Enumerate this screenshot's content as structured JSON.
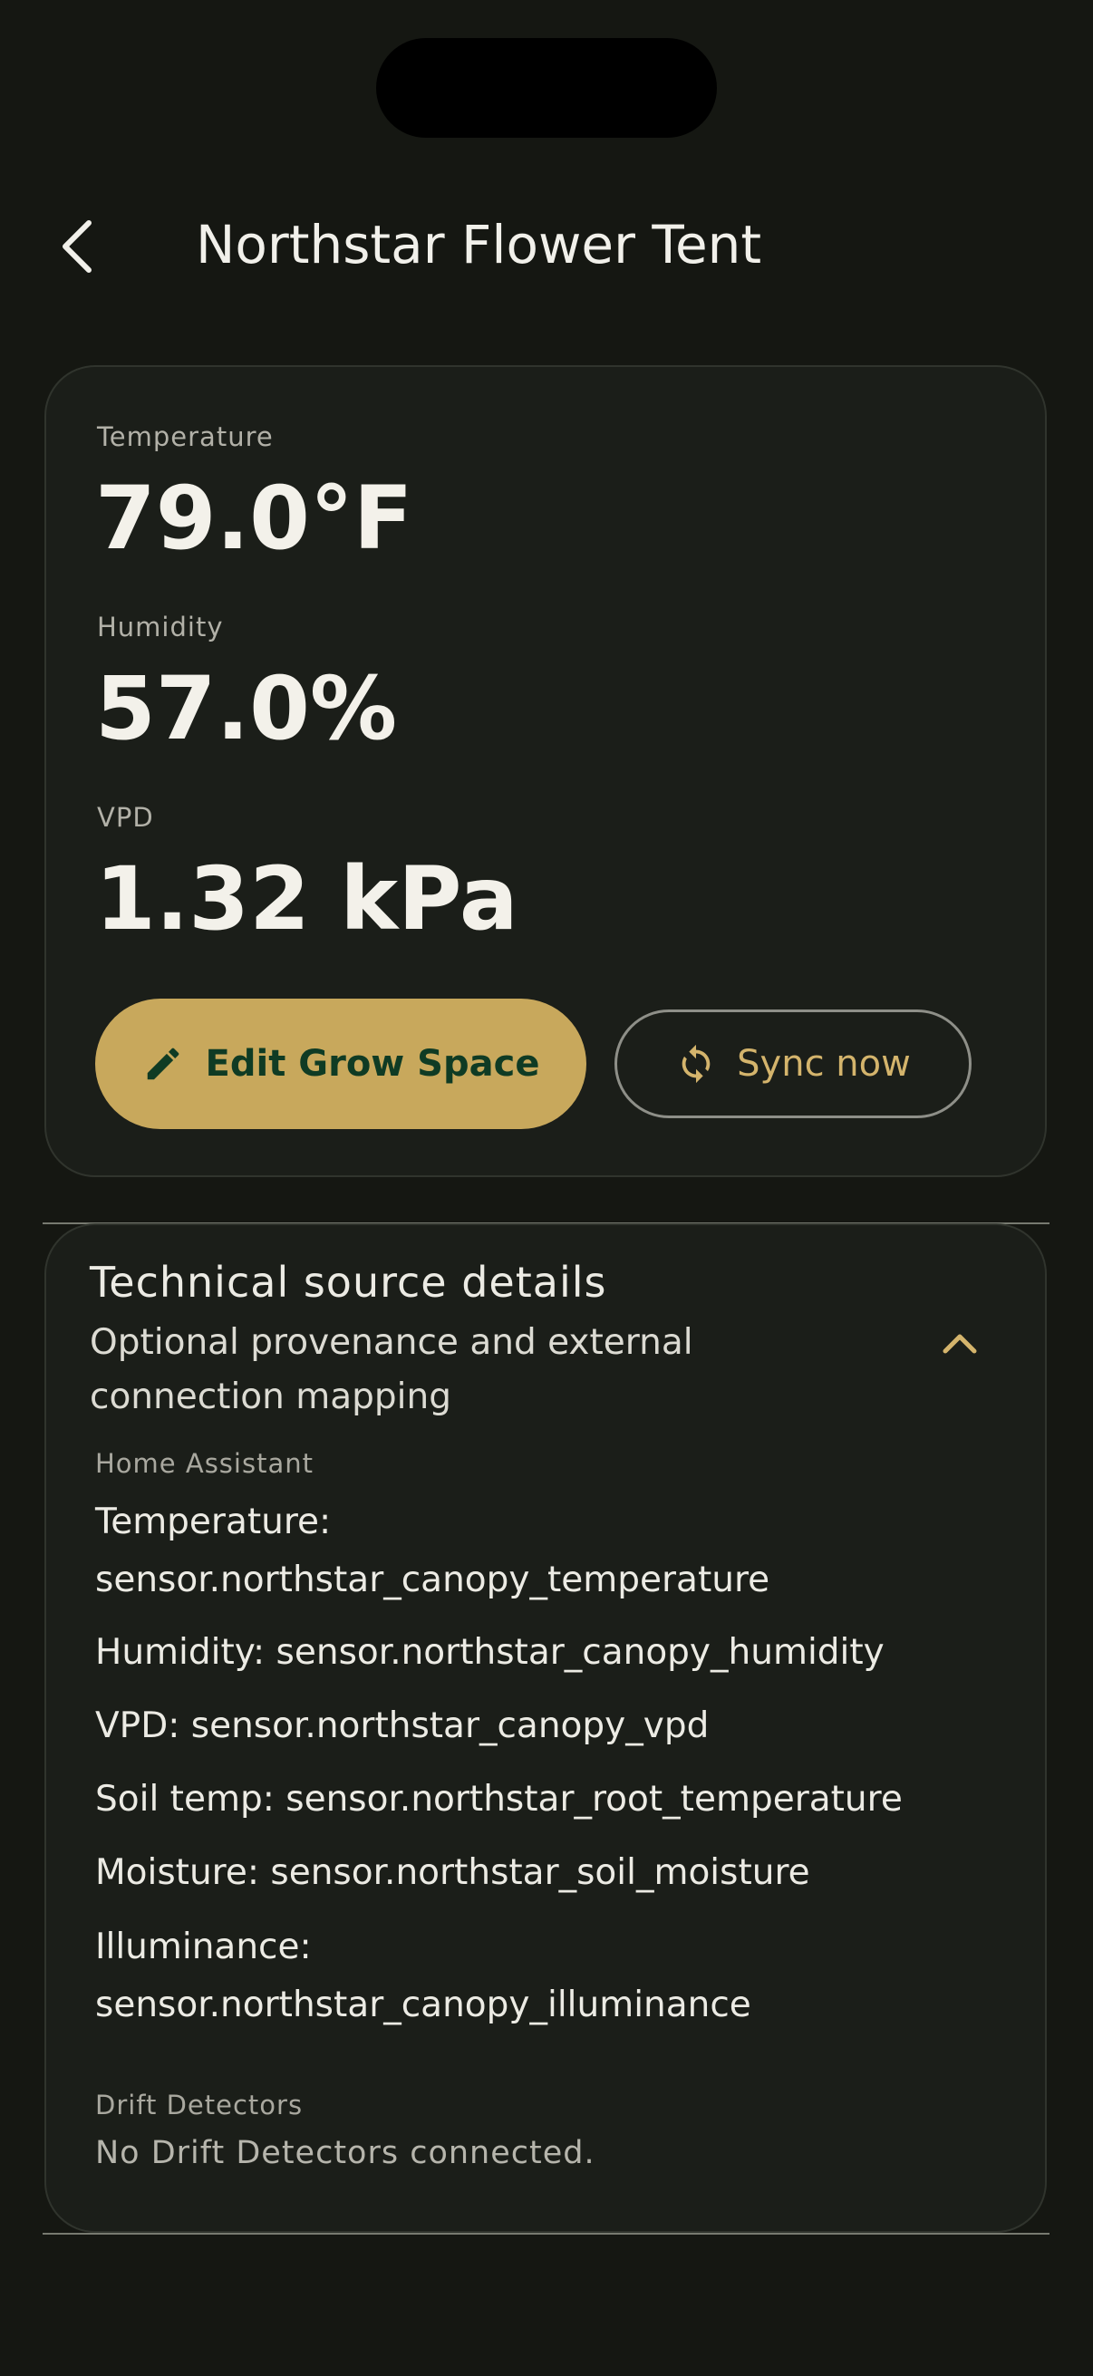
{
  "header": {
    "title": "Northstar Flower Tent"
  },
  "metrics": [
    {
      "label": "Temperature",
      "value": "79.0°F"
    },
    {
      "label": "Humidity",
      "value": "57.0%"
    },
    {
      "label": "VPD",
      "value": "1.32 kPa"
    }
  ],
  "actions": {
    "edit_label": "Edit Grow Space",
    "sync_label": "Sync now"
  },
  "technical": {
    "title": "Technical source details",
    "subtitle": "Optional provenance and external connection mapping",
    "expanded": true,
    "home_assistant_label": "Home Assistant",
    "mappings": [
      "Temperature: sensor.northstar_canopy_temperature",
      "Humidity: sensor.northstar_canopy_humidity",
      "VPD: sensor.northstar_canopy_vpd",
      "Soil temp: sensor.northstar_root_temperature",
      "Moisture: sensor.northstar_soil_moisture",
      "Illuminance: sensor.northstar_canopy_illuminance"
    ],
    "drift_label": "Drift Detectors",
    "drift_empty": "No Drift Detectors connected."
  },
  "icons": {
    "back": "chevron-left-icon",
    "edit": "pencil-icon",
    "sync": "sync-icon",
    "collapse": "chevron-up-icon"
  },
  "colors": {
    "background": "#151712",
    "card": "#1b1e19",
    "accent": "#c8a85c",
    "accent_text": "#0f3b24",
    "sync_text": "#d4b46c"
  }
}
